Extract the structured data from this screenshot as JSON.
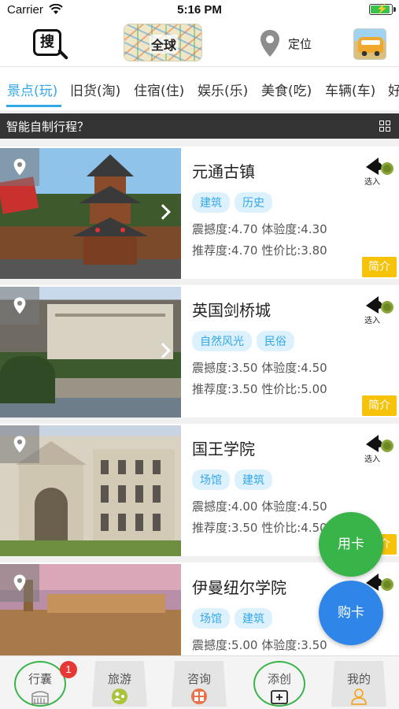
{
  "status_bar": {
    "carrier": "Carrier",
    "time": "5:16 PM",
    "battery_level": 0.85
  },
  "header": {
    "search_label": "搜",
    "global_label": "全球",
    "locate_label": "定位"
  },
  "tabs": [
    "景点(玩)",
    "旧货(淘)",
    "住宿(住)",
    "娱乐(乐)",
    "美食(吃)",
    "车辆(车)",
    "好"
  ],
  "active_tab": 0,
  "plan_bar": {
    "text": "智能自制行程？"
  },
  "attractions": [
    {
      "name": "元通古镇",
      "tags": [
        "建筑",
        "历史"
      ],
      "line1": "震撼度:4.70 体验度:4.30",
      "line2": "推荐度:4.70 性价比:3.80",
      "select_label": "选入",
      "intro_label": "简介"
    },
    {
      "name": "英国剑桥城",
      "tags": [
        "自然风光",
        "民俗"
      ],
      "line1": "震撼度:3.50 体验度:4.50",
      "line2": "推荐度:3.50 性价比:5.00",
      "select_label": "选入",
      "intro_label": "简介"
    },
    {
      "name": "国王学院",
      "tags": [
        "场馆",
        "建筑"
      ],
      "line1": "震撼度:4.00 体验度:4.50",
      "line2": "推荐度:3.50 性价比:4.50",
      "select_label": "选入",
      "intro_label": "简介"
    },
    {
      "name": "伊曼纽尔学院",
      "tags": [
        "场馆",
        "建筑"
      ],
      "line1": "震撼度:5.00 体验度:3.50",
      "line2": "",
      "select_label": "选入",
      "intro_label": ""
    }
  ],
  "fab": {
    "use_card": "用卡",
    "buy_card": "购卡"
  },
  "bottom_nav": [
    {
      "label": "行囊",
      "badge": "1",
      "style": "circle",
      "icon": "colosseum-icon"
    },
    {
      "label": "旅游",
      "badge": "",
      "style": "trap",
      "icon": "travel-icon"
    },
    {
      "label": "咨询",
      "badge": "",
      "style": "trap",
      "icon": "consult-icon"
    },
    {
      "label": "添创",
      "badge": "",
      "style": "circle",
      "icon": "add-create-icon"
    },
    {
      "label": "我的",
      "badge": "",
      "style": "trap",
      "icon": "profile-icon"
    }
  ],
  "colors": {
    "accent": "#33a8e8",
    "green": "#38b449",
    "blue": "#2f86e8",
    "yellow": "#f6c20a",
    "dark_bar": "#333333"
  }
}
